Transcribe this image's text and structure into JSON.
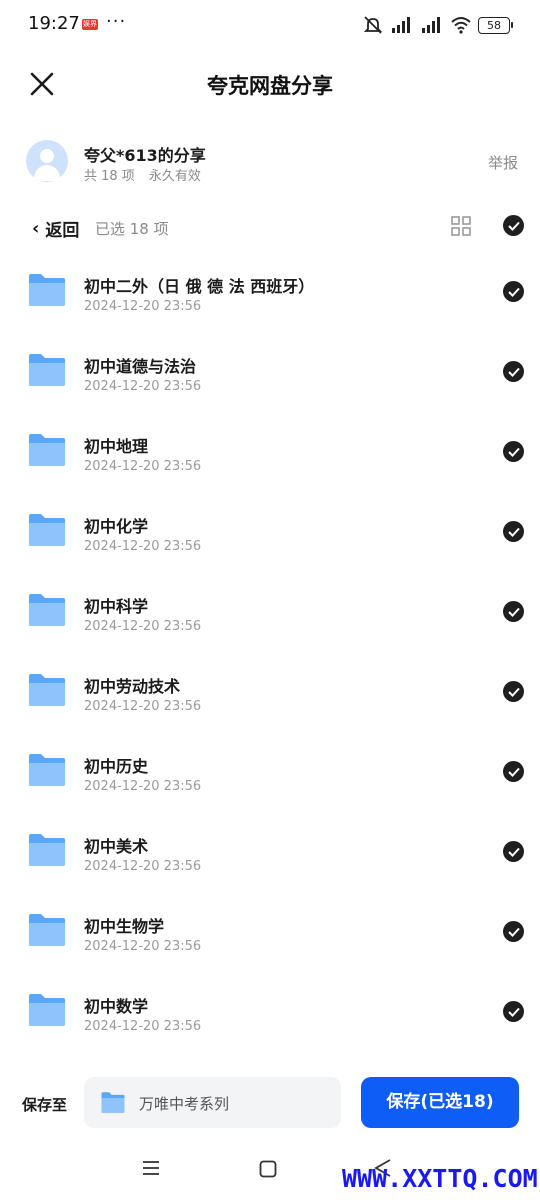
{
  "status_bar": {
    "time": "19:27",
    "badge_text": "娱界",
    "dots": "···",
    "battery": "58"
  },
  "header": {
    "title": "夸克网盘分享"
  },
  "share": {
    "owner": "夸父*613的分享",
    "count": "共 18 项",
    "validity": "永久有效",
    "report_label": "举报"
  },
  "toolbar": {
    "back_label": "返回",
    "selected": "已选 18 项"
  },
  "files": [
    {
      "name": "初中二外（日 俄 德 法 西班牙）",
      "date": "2024-12-20 23:56"
    },
    {
      "name": "初中道德与法治",
      "date": "2024-12-20 23:56"
    },
    {
      "name": "初中地理",
      "date": "2024-12-20 23:56"
    },
    {
      "name": "初中化学",
      "date": "2024-12-20 23:56"
    },
    {
      "name": "初中科学",
      "date": "2024-12-20 23:56"
    },
    {
      "name": "初中劳动技术",
      "date": "2024-12-20 23:56"
    },
    {
      "name": "初中历史",
      "date": "2024-12-20 23:56"
    },
    {
      "name": "初中美术",
      "date": "2024-12-20 23:56"
    },
    {
      "name": "初中生物学",
      "date": "2024-12-20 23:56"
    },
    {
      "name": "初中数学",
      "date": "2024-12-20 23:56"
    }
  ],
  "bottom": {
    "save_to_label": "保存至",
    "destination": "万唯中考系列",
    "save_button": "保存(已选18)"
  },
  "watermark": "WWW.XXTTQ.COM",
  "colors": {
    "primary": "#0e5df7",
    "folder": "#5aa8f5",
    "check": "#1f1f1f"
  }
}
